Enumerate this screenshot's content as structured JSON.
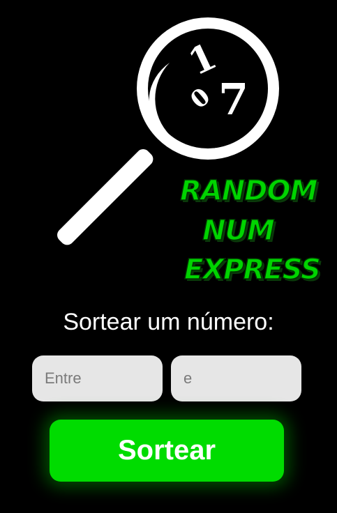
{
  "logo": {
    "digit_top": "1",
    "digit_mid": "0",
    "digit_right": "7",
    "word_line1": "RANDOM",
    "word_line2": "NUM",
    "word_line3": "EXPRESS",
    "icon": "magnifying-glass-icon"
  },
  "form": {
    "prompt": "Sortear um número:",
    "from_placeholder": "Entre",
    "to_placeholder": "e",
    "submit_label": "Sortear"
  },
  "colors": {
    "background": "#000000",
    "accent": "#00dc00",
    "input_bg": "#e6e6e6",
    "text": "#ffffff"
  }
}
